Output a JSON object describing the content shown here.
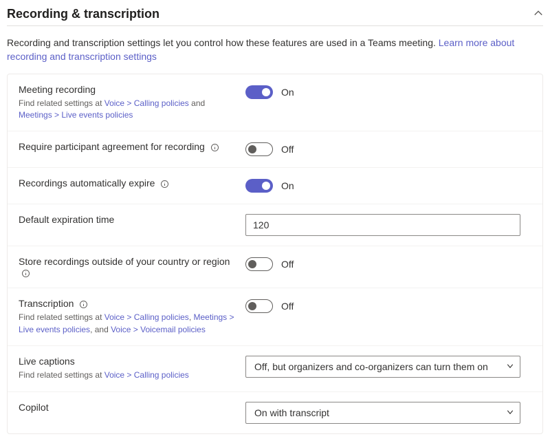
{
  "header": {
    "title": "Recording & transcription"
  },
  "description": {
    "prefix": "Recording and transcription settings let you control how these features are used in a Teams meeting. ",
    "link": "Learn more about recording and transcription settings"
  },
  "labels": {
    "on": "On",
    "off": "Off",
    "find_related": "Find related settings at ",
    "and": " and ",
    "and_comma": ", and "
  },
  "links": {
    "voice_calling": "Voice > Calling policies",
    "meetings_live_events": "Meetings > Live events policies",
    "voice_voicemail": "Voice > Voicemail policies"
  },
  "rows": {
    "meeting_recording": {
      "title": "Meeting recording",
      "state": "on"
    },
    "participant_agreement": {
      "title": "Require participant agreement for recording",
      "state": "off"
    },
    "auto_expire": {
      "title": "Recordings automatically expire",
      "state": "on"
    },
    "default_expiration": {
      "title": "Default expiration time",
      "value": "120"
    },
    "store_outside": {
      "title": "Store recordings outside of your country or region",
      "state": "off"
    },
    "transcription": {
      "title": "Transcription",
      "state": "off"
    },
    "live_captions": {
      "title": "Live captions",
      "value": "Off, but organizers and co-organizers can turn them on"
    },
    "copilot": {
      "title": "Copilot",
      "value": "On with transcript"
    }
  }
}
